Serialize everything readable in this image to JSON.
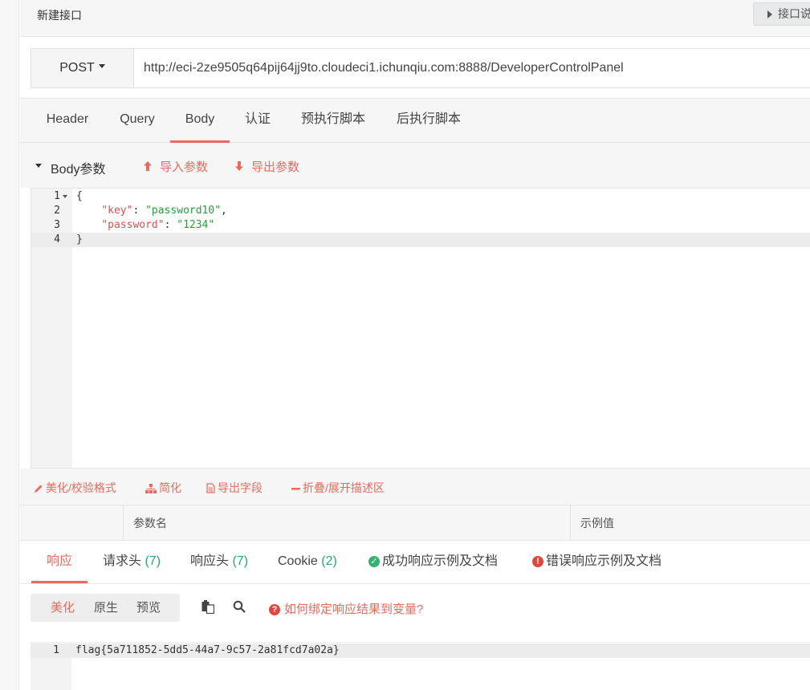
{
  "header": {
    "title": "新建接口",
    "doc_button": "接口说"
  },
  "request": {
    "method": "POST",
    "url": "http://eci-2ze9505q64pij64jj9to.cloudeci1.ichunqiu.com:8888/DeveloperControlPanel"
  },
  "req_tabs": [
    "Header",
    "Query",
    "Body",
    "认证",
    "预执行脚本",
    "后执行脚本"
  ],
  "body_section": {
    "label": "Body参数",
    "import": "导入参数",
    "export": "导出参数"
  },
  "editor": {
    "line_numbers": [
      "1",
      "2",
      "3",
      "4"
    ],
    "open_brace": "{",
    "key1": "\"key\"",
    "val1": "\"password10\"",
    "key2": "\"password\"",
    "val2": "\"1234\"",
    "close_brace": "}"
  },
  "editor_tools": {
    "beautify": "美化/校验格式",
    "simplify": "简化",
    "export_fields": "导出字段",
    "fold": "折叠/展开描述区"
  },
  "param_table": {
    "name_header": "参数名",
    "example_header": "示例值"
  },
  "response_tabs": {
    "response": "响应",
    "req_headers": "请求头",
    "req_headers_count": "(7)",
    "resp_headers": "响应头",
    "resp_headers_count": "(7)",
    "cookie": "Cookie",
    "cookie_count": "(2)",
    "success_doc": "成功响应示例及文档",
    "error_doc": "错误响应示例及文档"
  },
  "response_tools": {
    "beautify": "美化",
    "raw": "原生",
    "preview": "预览",
    "help": "如何绑定响应结果到变量?"
  },
  "output": {
    "line_number": "1",
    "text": "flag{5a711852-5dd5-44a7-9c57-2a81fcd7a02a}"
  },
  "colors": {
    "accent": "#e76b5e",
    "count_green": "#2aa876",
    "json_key": "#d9534f",
    "json_string": "#2a9d3c"
  }
}
